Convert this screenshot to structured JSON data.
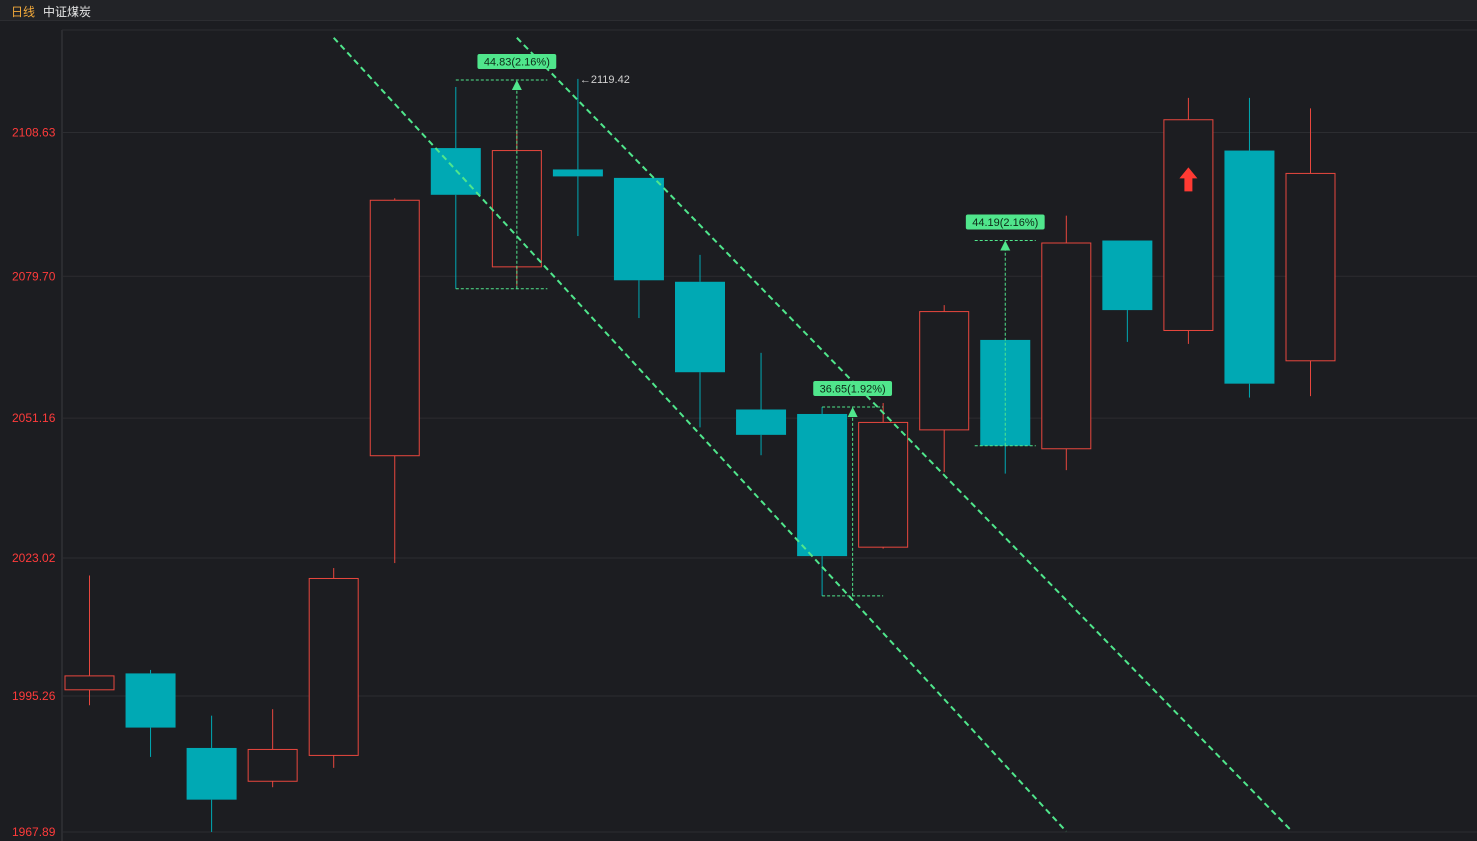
{
  "header": {
    "period": "日线",
    "name": "中证煤炭"
  },
  "colors": {
    "background": "#1c1d21",
    "grid": "#2c2d31",
    "up": "#e8473e",
    "down": "#00a9b4",
    "annotation": "#50e68c",
    "axis_text": "#ff3b3b",
    "label_text": "#d0d0d0"
  },
  "chart_data": {
    "type": "candlestick",
    "y_ticks": [
      "2108.63",
      "2079.70",
      "2051.16",
      "2023.02",
      "1995.26",
      "1967.89"
    ],
    "ylim": [
      1967.89,
      2124.5
    ],
    "candles": [
      {
        "open": 1996.5,
        "close": 1999.3,
        "high": 2019.5,
        "low": 1993.4
      },
      {
        "open": 1999.8,
        "close": 1988.9,
        "high": 2000.5,
        "low": 1983.0
      },
      {
        "open": 1984.8,
        "close": 1974.4,
        "high": 1991.3,
        "low": 1967.9
      },
      {
        "open": 1978.1,
        "close": 1984.5,
        "high": 1992.6,
        "low": 1976.9
      },
      {
        "open": 1983.3,
        "close": 2018.9,
        "high": 2021.0,
        "low": 1980.8
      },
      {
        "open": 2043.6,
        "close": 2095.0,
        "high": 2095.4,
        "low": 2022.0
      },
      {
        "open": 2105.5,
        "close": 2096.1,
        "high": 2117.8,
        "low": 2077.2
      },
      {
        "open": 2081.6,
        "close": 2105.0,
        "high": 2109.2,
        "low": 2077.8
      },
      {
        "open": 2101.2,
        "close": 2099.8,
        "high": 2119.42,
        "low": 2087.8
      },
      {
        "open": 2099.5,
        "close": 2078.9,
        "high": 2099.5,
        "low": 2071.3
      },
      {
        "open": 2078.6,
        "close": 2060.4,
        "high": 2084.0,
        "low": 2049.3
      },
      {
        "open": 2052.9,
        "close": 2047.8,
        "high": 2064.3,
        "low": 2043.7
      },
      {
        "open": 2052.0,
        "close": 2023.4,
        "high": 2053.4,
        "low": 2015.4
      },
      {
        "open": 2025.2,
        "close": 2050.3,
        "high": 2054.2,
        "low": 2024.9
      },
      {
        "open": 2048.8,
        "close": 2072.6,
        "high": 2073.9,
        "low": 2040.3
      },
      {
        "open": 2066.9,
        "close": 2045.6,
        "high": 2066.9,
        "low": 2040.0
      },
      {
        "open": 2045.0,
        "close": 2086.4,
        "high": 2091.9,
        "low": 2040.7
      },
      {
        "open": 2086.9,
        "close": 2072.9,
        "high": 2086.9,
        "low": 2066.5
      },
      {
        "open": 2068.8,
        "close": 2111.2,
        "high": 2115.6,
        "low": 2066.1
      },
      {
        "open": 2105.0,
        "close": 2058.1,
        "high": 2115.6,
        "low": 2055.3
      },
      {
        "open": 2062.7,
        "close": 2100.4,
        "high": 2113.5,
        "low": 2055.6
      }
    ],
    "high_marker": {
      "index": 8,
      "label": "←2119.42"
    },
    "channel_lines": [
      {
        "from": {
          "index": 4,
          "price": 2127.7
        },
        "to": {
          "index": 16,
          "price": 1968.0
        }
      },
      {
        "from": {
          "index": 7,
          "price": 2127.7
        },
        "to": {
          "index": 19.7,
          "price": 1968.0
        }
      }
    ],
    "measurements": [
      {
        "label": "44.83(2.16%)",
        "x_index": 7,
        "x_from": 6.0,
        "x_to": 7.5,
        "low": 2077.2,
        "high": 2119.2
      },
      {
        "label": "36.65(1.92%)",
        "x_index": 12.5,
        "x_from": 12.0,
        "x_to": 13.0,
        "low": 2015.4,
        "high": 2053.4
      },
      {
        "label": "44.19(2.16%)",
        "x_index": 15,
        "x_from": 14.5,
        "x_to": 15.5,
        "low": 2045.6,
        "high": 2086.9
      }
    ],
    "signal_arrow": {
      "index": 18,
      "price": 2099.0,
      "direction": "up"
    }
  }
}
